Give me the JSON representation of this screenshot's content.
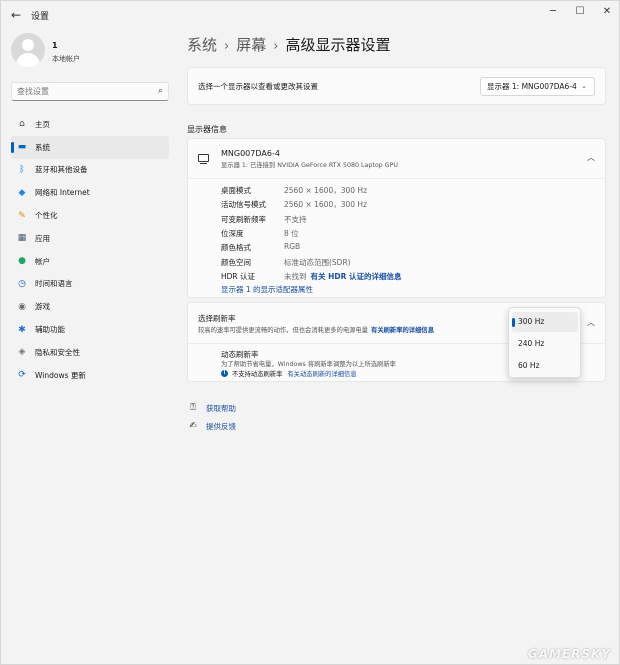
{
  "window": {
    "title": "设置",
    "back_glyph": "←",
    "minimize_glyph": "─",
    "maximize_glyph": "☐",
    "close_glyph": "✕"
  },
  "profile": {
    "name": "1",
    "account_type": "本地帐户"
  },
  "search": {
    "placeholder": "查找设置",
    "icon_glyph": "⌕"
  },
  "nav": {
    "items": [
      {
        "label": "主页",
        "icon": "home-icon",
        "glyph": "⌂",
        "color": "#444444",
        "active": false
      },
      {
        "label": "系统",
        "icon": "system-icon",
        "glyph": "▬",
        "color": "#0067c0",
        "active": true
      },
      {
        "label": "蓝牙和其他设备",
        "icon": "bluetooth-icon",
        "glyph": "ᛒ",
        "color": "#0078d4",
        "active": false
      },
      {
        "label": "网络和 Internet",
        "icon": "network-icon",
        "glyph": "◆",
        "color": "#1e88e5",
        "active": false
      },
      {
        "label": "个性化",
        "icon": "personalization-icon",
        "glyph": "✎",
        "color": "#e08a00",
        "active": false
      },
      {
        "label": "应用",
        "icon": "apps-icon",
        "glyph": "▦",
        "color": "#4a5a70",
        "active": false
      },
      {
        "label": "帐户",
        "icon": "accounts-icon",
        "glyph": "●",
        "color": "#1fa56a",
        "active": false
      },
      {
        "label": "时间和语言",
        "icon": "time-language-icon",
        "glyph": "◷",
        "color": "#1e63b5",
        "active": false
      },
      {
        "label": "游戏",
        "icon": "gaming-icon",
        "glyph": "◉",
        "color": "#6b6b6b",
        "active": false
      },
      {
        "label": "辅助功能",
        "icon": "accessibility-icon",
        "glyph": "✱",
        "color": "#1e6fd0",
        "active": false
      },
      {
        "label": "隐私和安全性",
        "icon": "privacy-shield-icon",
        "glyph": "◈",
        "color": "#707070",
        "active": false
      },
      {
        "label": "Windows 更新",
        "icon": "windows-update-icon",
        "glyph": "⟳",
        "color": "#0067c0",
        "active": false
      }
    ]
  },
  "breadcrumb": {
    "level1": "系统",
    "level2": "屏幕",
    "current": "高级显示器设置",
    "separator": "›"
  },
  "selector": {
    "label": "选择一个显示器以查看或更改其设置",
    "value": "显示器 1: MNG007DA6-4",
    "chevron": "⌄"
  },
  "display_info": {
    "section_title": "显示器信息",
    "monitor_name": "MNG007DA6-4",
    "monitor_sub": "显示器 1: 已连接到 NVIDIA GeForce RTX 5080 Laptop GPU",
    "chevron": "︿",
    "rows": [
      {
        "label": "桌面模式",
        "value": "2560 × 1600，300 Hz",
        "link": ""
      },
      {
        "label": "活动信号模式",
        "value": "2560 × 1600，300 Hz",
        "link": ""
      },
      {
        "label": "可变刷新频率",
        "value": "不支持",
        "link": ""
      },
      {
        "label": "位深度",
        "value": "8 位",
        "link": ""
      },
      {
        "label": "颜色格式",
        "value": "RGB",
        "link": ""
      },
      {
        "label": "颜色空间",
        "value": "标准动态范围(SDR)",
        "link": ""
      },
      {
        "label": "HDR 认证",
        "value": "未找到",
        "link": "有关 HDR 认证的详细信息"
      }
    ],
    "adapter_link": "显示器 1 的显示适配器属性"
  },
  "refresh_rate": {
    "title": "选择刷新率",
    "description": "较高的速率可提供更流畅的动作，但也会消耗更多的电源电量",
    "description_link": "有关刷新率的详细信息",
    "chevron": "︿",
    "options": [
      "300 Hz",
      "240 Hz",
      "60 Hz"
    ],
    "selected_index": 0,
    "dynamic": {
      "title": "动态刷新率",
      "description": "为了帮助节省电量，Windows 将刷新率调整为以上所选刷新率",
      "status_glyph": "i",
      "status": "不支持动态刷新率",
      "status_link": "有关动态刷新的详细信息"
    }
  },
  "help": {
    "get_help": "获取帮助",
    "get_help_glyph": "⍰",
    "feedback": "提供反馈",
    "feedback_glyph": "✍"
  },
  "watermark": "GAMERSKY",
  "colors": {
    "accent": "#005fb8",
    "link": "#1a4fa0",
    "background": "#f3f3f3",
    "card": "#fbfbfb"
  }
}
